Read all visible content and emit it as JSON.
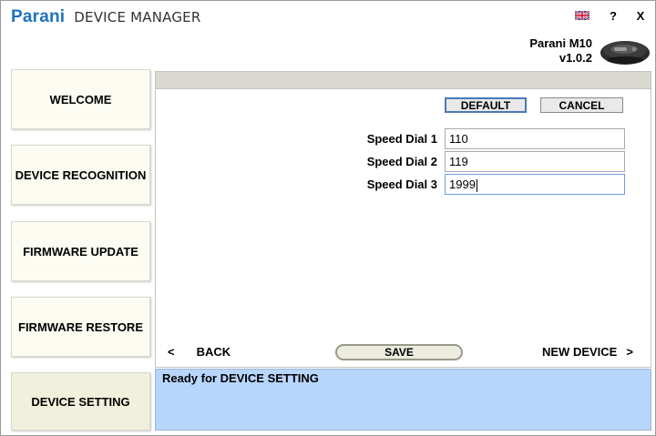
{
  "app": {
    "brand": "Parani",
    "title": "DEVICE MANAGER"
  },
  "window_controls": {
    "flag_icon": "uk-flag-icon",
    "help_label": "?",
    "close_label": "X"
  },
  "device": {
    "name": "Parani M10",
    "version": "v1.0.2",
    "image_icon": "headset-device-icon"
  },
  "sidebar": {
    "items": [
      {
        "label": "WELCOME"
      },
      {
        "label": "DEVICE RECOGNITION"
      },
      {
        "label": "FIRMWARE UPDATE"
      },
      {
        "label": "FIRMWARE RESTORE"
      },
      {
        "label": "DEVICE SETTING"
      }
    ],
    "active": "DEVICE SETTING"
  },
  "toolbar": {
    "default_label": "DEFAULT",
    "cancel_label": "CANCEL"
  },
  "fields": [
    {
      "label": "Speed Dial 1",
      "value": "110"
    },
    {
      "label": "Speed Dial 2",
      "value": "119"
    },
    {
      "label": "Speed Dial 3",
      "value": "1999"
    }
  ],
  "navigation": {
    "back_arrow": "<",
    "back_label": "BACK",
    "save_label": "SAVE",
    "next_label": "NEW DEVICE",
    "next_arrow": ">"
  },
  "status": {
    "text": "Ready for DEVICE SETTING"
  },
  "colors": {
    "brand_blue": "#1e73be",
    "status_bg": "#b8d6fc",
    "nav_bg": "#fcfcf3"
  }
}
